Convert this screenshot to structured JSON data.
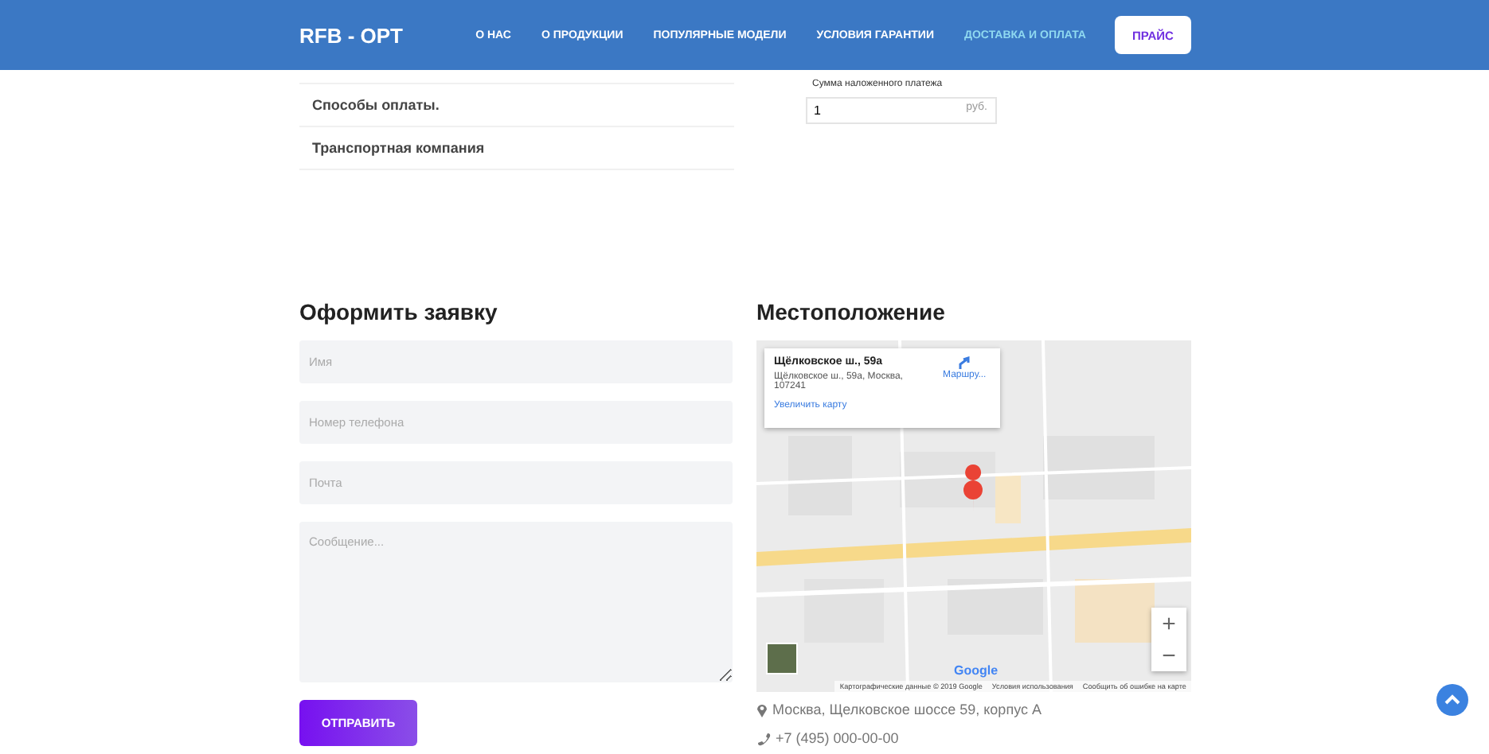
{
  "header": {
    "logo": "RFB - OPT",
    "nav": [
      {
        "label": "О НАС",
        "selected": false
      },
      {
        "label": "О ПРОДУКЦИИ",
        "selected": false
      },
      {
        "label": "ПОПУЛЯРНЫЕ МОДЕЛИ",
        "selected": false
      },
      {
        "label": "УСЛОВИЯ ГАРАНТИИ",
        "selected": false
      },
      {
        "label": "ДОСТАВКА И ОПЛАТА",
        "selected": true
      }
    ],
    "price_button": "ПРАЙС"
  },
  "delivery": {
    "sections": [
      "Способы оплаты.",
      "Транспортная компания"
    ],
    "cod_field": {
      "label": "Сумма наложенного платежа",
      "value": "1",
      "unit": "руб."
    }
  },
  "order_form": {
    "title": "Оформить заявку",
    "fields": [
      {
        "kind": "input",
        "placeholder": "Имя"
      },
      {
        "kind": "input",
        "placeholder": "Номер телефона"
      },
      {
        "kind": "input",
        "placeholder": "Почта"
      },
      {
        "kind": "textarea",
        "placeholder": "Сообщение..."
      }
    ],
    "submit": "ОТПРАВИТЬ"
  },
  "location": {
    "title": "Местоположение",
    "map": {
      "kind": "picture",
      "info_card": {
        "title": "Щёлковское ш., 59а",
        "address": "Щёлковское ш., 59а, Москва, 107241",
        "directions": "Маршру...",
        "enlarge_link": "Увеличить карту"
      },
      "zoom_in": "+",
      "zoom_out": "−",
      "google": "Google",
      "attribution": [
        "Картографические данные © 2019 Google",
        "Условия использования",
        "Сообщить об ошибке на карте"
      ]
    },
    "address": "Москва, Щелковское шоссе 59, корпус А",
    "phone": "+7 (495) 000-00-00"
  }
}
